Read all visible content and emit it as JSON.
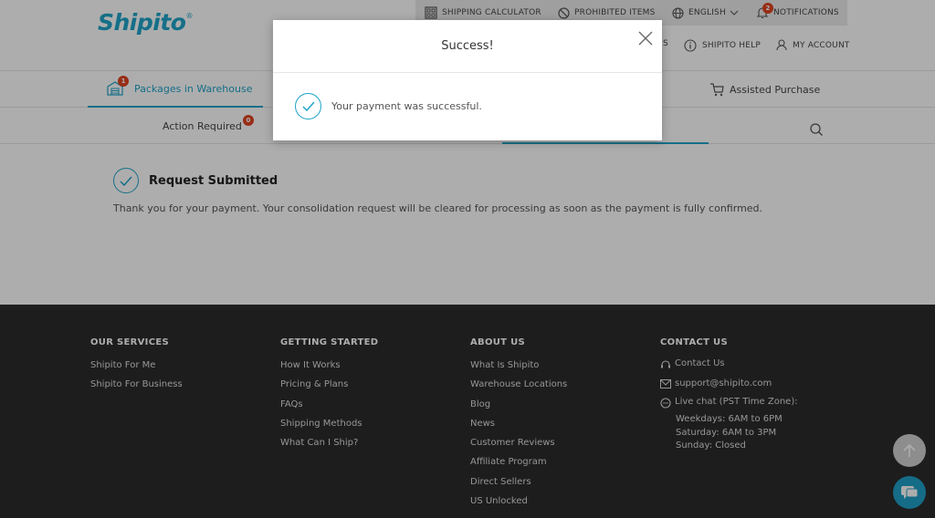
{
  "header": {
    "logo": "Shipito",
    "logo_mark": "®",
    "topbar": {
      "shipping_calculator": "SHIPPING CALCULATOR",
      "prohibited_items": "PROHIBITED ITEMS",
      "language": "ENGLISH",
      "notifications": "NOTIFICATIONS",
      "notifications_count": "2"
    },
    "subnav": {
      "partial": "S",
      "help": "SHIPITO HELP",
      "account": "MY ACCOUNT"
    }
  },
  "tabs": {
    "packages": "Packages in Warehouse",
    "packages_count": "1",
    "assisted": "Assisted Purchase"
  },
  "subtabs": {
    "action_required": "Action Required",
    "action_count": "0"
  },
  "main": {
    "title": "Request Submitted",
    "message": "Thank you for your payment. Your consolidation request will be cleared for processing as soon as the payment is fully confirmed."
  },
  "footer": {
    "services": {
      "heading": "OUR SERVICES",
      "items": [
        "Shipito For Me",
        "Shipito For Business"
      ]
    },
    "getting_started": {
      "heading": "GETTING STARTED",
      "items": [
        "How It Works",
        "Pricing & Plans",
        "FAQs",
        "Shipping Methods",
        "What Can I Ship?"
      ]
    },
    "about": {
      "heading": "ABOUT US",
      "items": [
        "What Is Shipito",
        "Warehouse Locations",
        "Blog",
        "News",
        "Customer Reviews",
        "Affiliate Program",
        "Direct Sellers",
        "US Unlocked"
      ]
    },
    "contact": {
      "heading": "CONTACT US",
      "contact_link": "Contact Us",
      "email": "support@shipito.com",
      "chat": "Live chat (PST Time Zone):",
      "hours": [
        "Weekdays: 6AM to 6PM",
        "Saturday: 6AM to 3PM",
        "Sunday: Closed"
      ]
    }
  },
  "modal": {
    "title": "Success!",
    "message": "Your payment was successful."
  },
  "colors": {
    "accent": "#1fa4c9",
    "badge": "#e0431f",
    "footer": "#2b2b2b"
  }
}
